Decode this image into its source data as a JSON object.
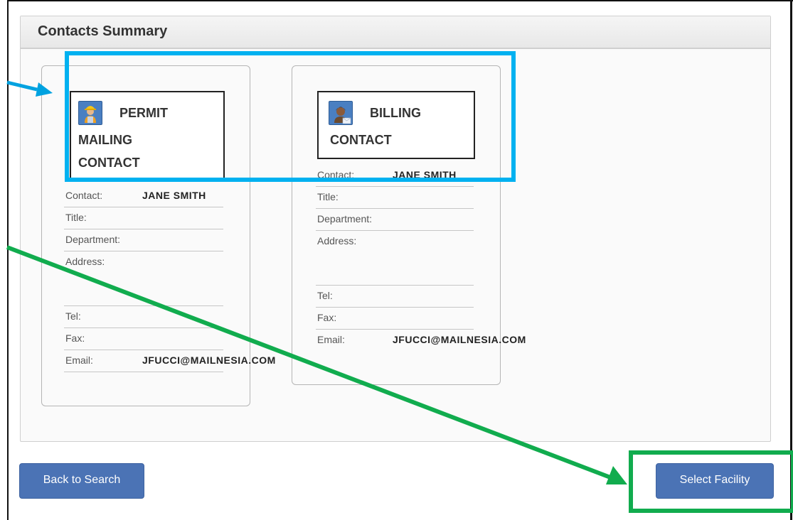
{
  "panel": {
    "title": "Contacts Summary"
  },
  "contacts": [
    {
      "type_line1": "PERMIT",
      "type_line2": "MAILING",
      "type_line3": "CONTACT",
      "icon": "construction-worker-avatar-icon",
      "fields": {
        "contact_label": "Contact:",
        "contact_value": "JANE SMITH",
        "title_label": "Title:",
        "department_label": "Department:",
        "address_label": "Address:",
        "tel_label": "Tel:",
        "fax_label": "Fax:",
        "email_label": "Email:",
        "email_value": "JFUCCI@MAILNESIA.COM"
      }
    },
    {
      "type_line1": "BILLING",
      "type_line2": "CONTACT",
      "icon": "headset-agent-avatar-icon",
      "fields": {
        "contact_label": "Contact:",
        "contact_value": "JANE SMITH",
        "title_label": "Title:",
        "department_label": "Department:",
        "address_label": "Address:",
        "tel_label": "Tel:",
        "fax_label": "Fax:",
        "email_label": "Email:",
        "email_value": "JFUCCI@MAILNESIA.COM"
      }
    }
  ],
  "buttons": {
    "back": "Back to Search",
    "select": "Select Facility"
  },
  "colors": {
    "button": "#4b73b5",
    "highlight_blue": "#00b1f0",
    "highlight_green": "#11ac4e"
  }
}
